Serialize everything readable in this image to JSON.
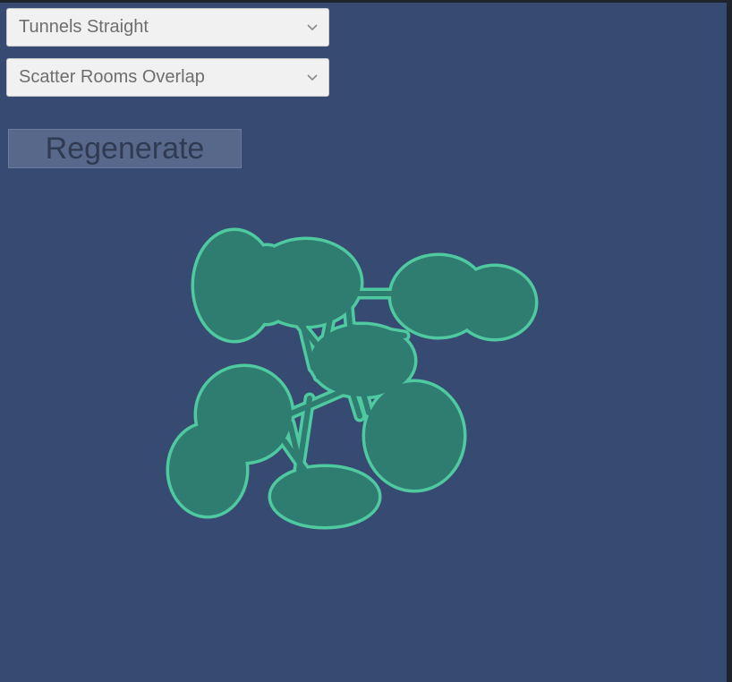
{
  "dropdowns": {
    "tunnel_mode": {
      "selected": "Tunnels Straight",
      "icon": "chevron-down-icon"
    },
    "room_mode": {
      "selected": "Scatter Rooms Overlap",
      "icon": "chevron-down-icon"
    }
  },
  "regenerate": {
    "label": "Regenerate"
  },
  "colors": {
    "background": "#374b72",
    "map_fill": "#2f7d71",
    "map_outline": "#4fcaa0",
    "button_fill": "#58688a",
    "dropdown_fill": "#f1f1f1"
  }
}
